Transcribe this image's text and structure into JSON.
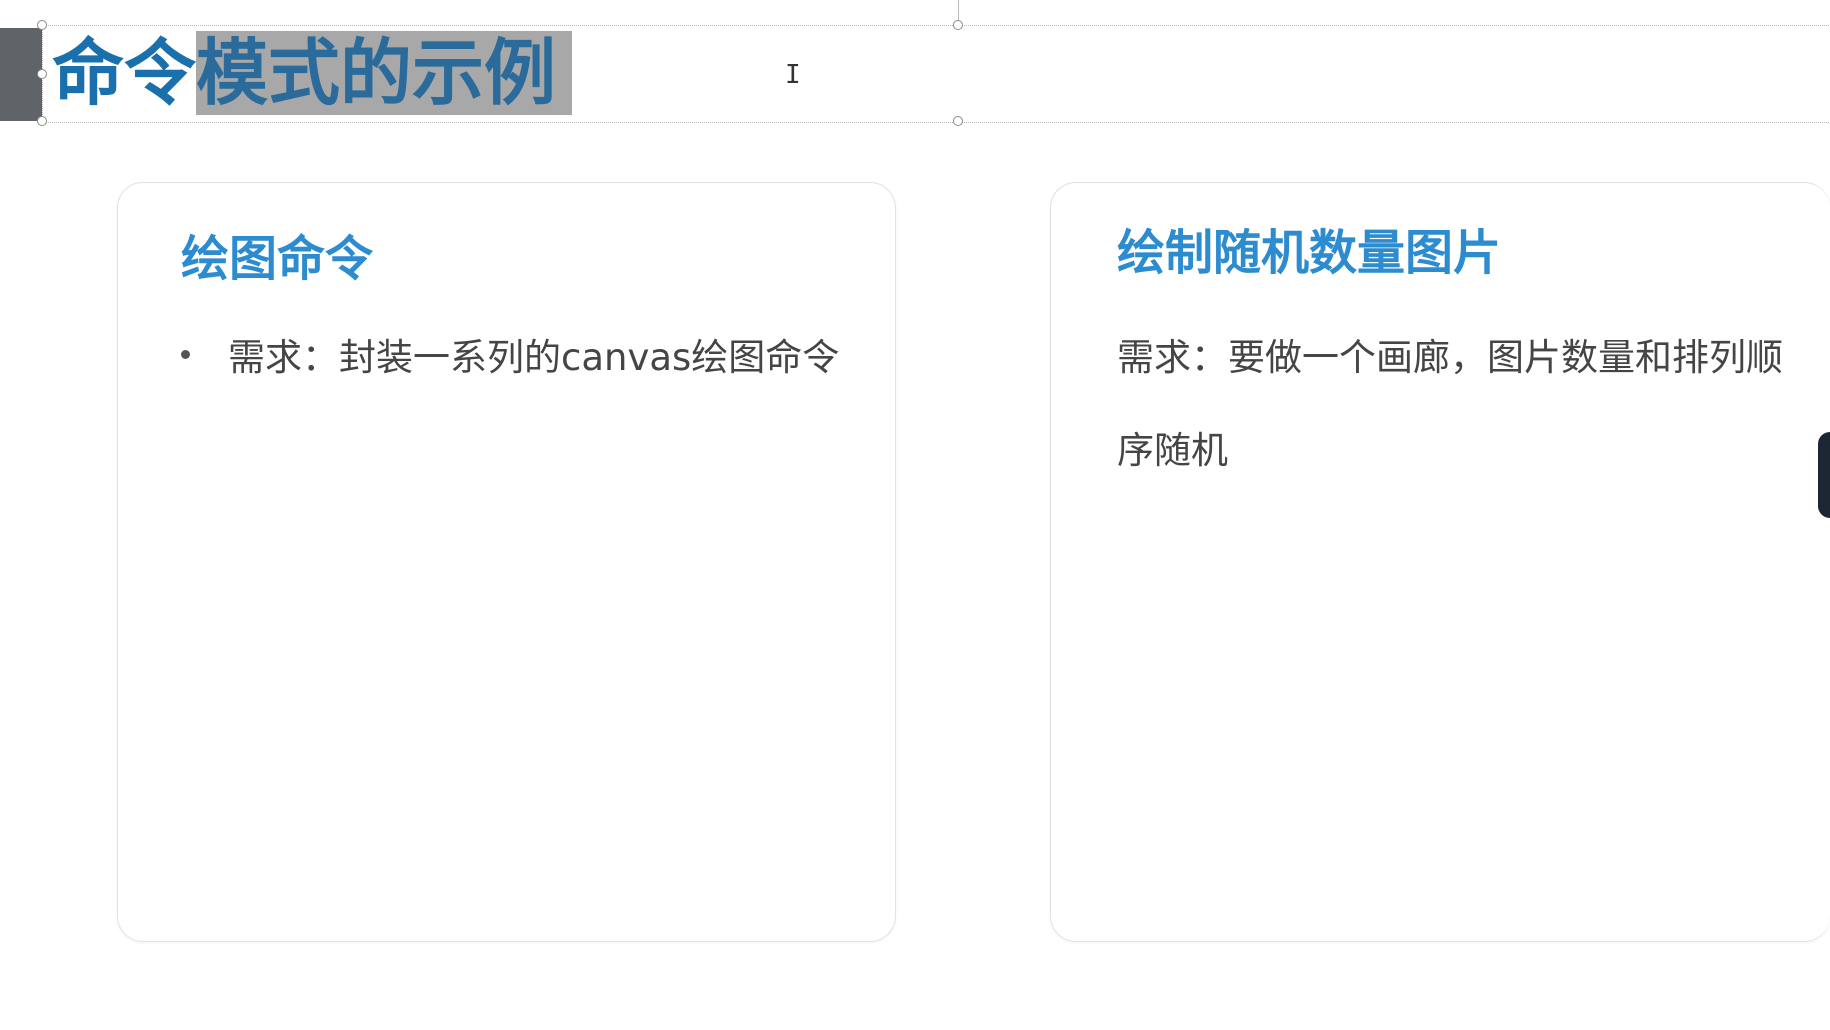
{
  "slide": {
    "title_plain": "命令",
    "title_selected": "模式的示例"
  },
  "cards": [
    {
      "heading": "绘图命令",
      "body": "需求：封装一系列的canvas绘图命令"
    },
    {
      "heading": "绘制随机数量图片",
      "body": "需求：要做一个画廊，图片数量和排列顺序随机"
    }
  ],
  "colors": {
    "title": "#1a70ad",
    "heading": "#2d8bd0",
    "body": "#454545",
    "selection": "#a8a8a8",
    "accent_bar": "#606368"
  },
  "cursor_icon": "text-ibeam-cursor"
}
